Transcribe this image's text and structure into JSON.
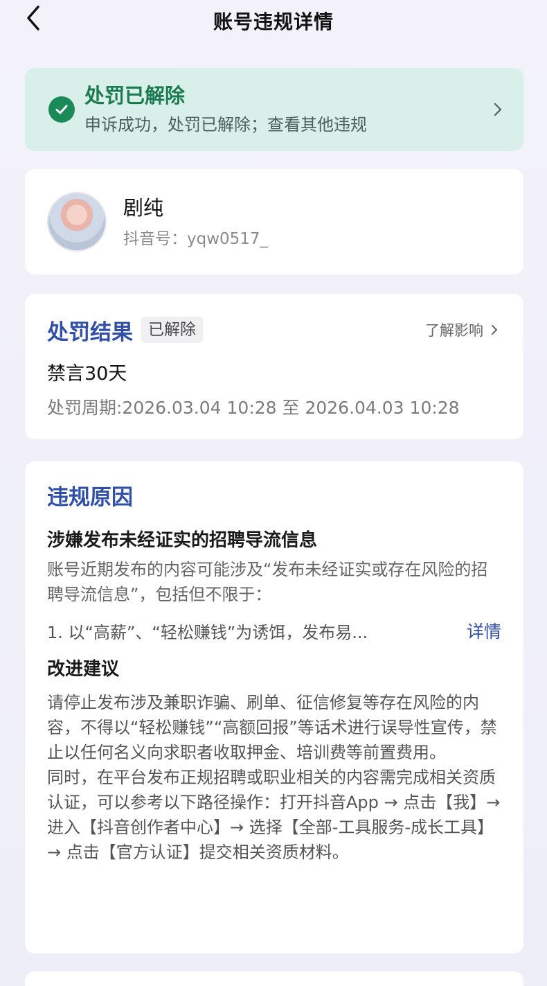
{
  "header": {
    "title": "账号违规详情"
  },
  "status": {
    "title": "处罚已解除",
    "subtitle": "申诉成功，处罚已解除；查看其他违规",
    "accent": "#1a8a59",
    "background": "#d9f0ea"
  },
  "profile": {
    "name": "剧纯",
    "id_line": "抖音号：yqw0517_"
  },
  "result": {
    "title": "处罚结果",
    "badge": "已解除",
    "learn_link": "了解影响",
    "punishment": "禁言30天",
    "period": "处罚周期:2026.03.04 10:28 至 2026.04.03 10:28"
  },
  "reason": {
    "title": "违规原因",
    "subtitle": "涉嫌发布未经证实的招聘导流信息",
    "description": "账号近期发布的内容可能涉及“发布未经证实或存在风险的招聘导流信息”，包括但不限于：",
    "item": "1. 以“高薪”、“轻松赚钱”为诱饵，发布易...",
    "detail_link": "详情",
    "suggest_title": "改进建议",
    "suggest_body": "请停止发布涉及兼职诈骗、刷单、征信修复等存在风险的内容，不得以“轻松赚钱”“高额回报”等话术进行误导性宣传，禁止以任何名义向求职者收取押金、培训费等前置费用。\n同时，在平台发布正规招聘或职业相关的内容需完成相关资质认证，可以参考以下路径操作：打开抖音App → 点击【我】→ 进入【抖音创作者中心】→ 选择【全部-工具服务-成长工具】→ 点击【官方认证】提交相关资质材料。"
  },
  "colors": {
    "link": "#2f4fa8",
    "success": "#1a8a59"
  }
}
